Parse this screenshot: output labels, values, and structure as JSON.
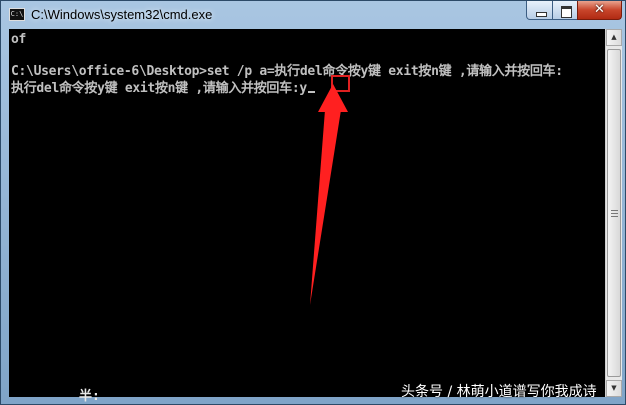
{
  "window": {
    "title": "C:\\Windows\\system32\\cmd.exe",
    "icon": "cmd-icon",
    "controls": {
      "minimize": "minimize-icon",
      "maximize": "maximize-icon",
      "close_label": "✕"
    }
  },
  "console": {
    "lines": [
      "of",
      "",
      "C:\\Users\\office-6\\Desktop>set /p a=执行del命令按y键 exit按n键 ,请输入并按回车:",
      "执行del命令按y键 exit按n键 ,请输入并按回车:y"
    ],
    "input_value": "y"
  },
  "ime_status": "半:",
  "watermark": "头条号 / 林萌小道谱写你我成诗",
  "colors": {
    "console_bg": "#000000",
    "console_text": "#c0c0c0",
    "annotation": "#e02020"
  }
}
